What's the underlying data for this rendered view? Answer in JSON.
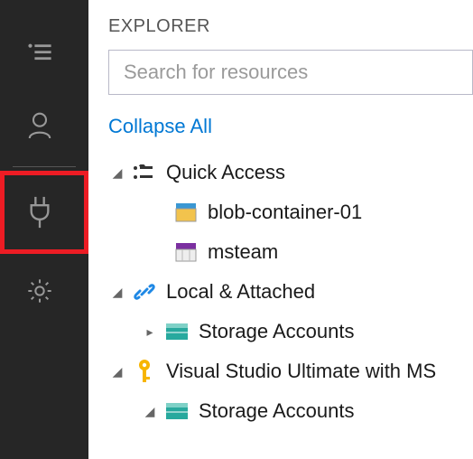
{
  "panel": {
    "title": "EXPLORER"
  },
  "search": {
    "placeholder": "Search for resources",
    "value": ""
  },
  "actions": {
    "collapse": "Collapse All"
  },
  "tree": {
    "quickAccess": {
      "label": "Quick Access",
      "items": [
        {
          "label": "blob-container-01"
        },
        {
          "label": "msteam"
        }
      ]
    },
    "localAttached": {
      "label": "Local & Attached",
      "storageAccounts": "Storage Accounts"
    },
    "subscription": {
      "label": "Visual Studio Ultimate with MS",
      "storageAccounts": "Storage Accounts"
    }
  },
  "icons": {
    "explorer": "explorer-list-icon",
    "account": "account-icon",
    "plug": "plug-icon",
    "gear": "gear-icon"
  }
}
